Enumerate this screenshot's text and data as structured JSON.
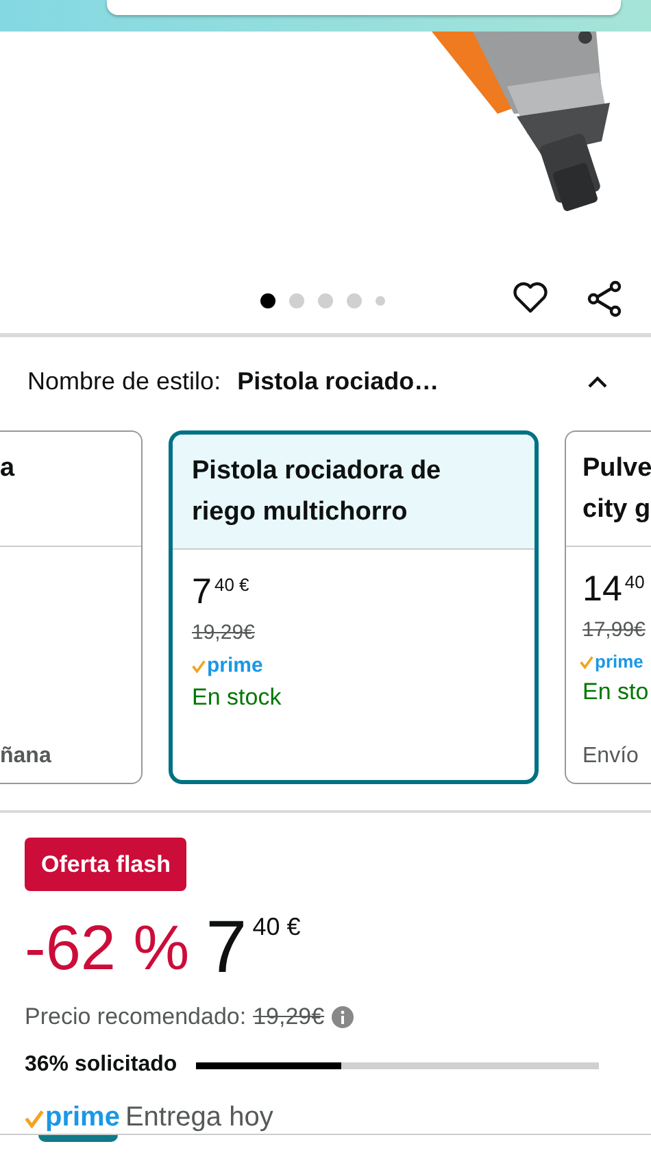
{
  "header": {
    "search": {
      "kind": "field"
    }
  },
  "gallery": {
    "dots": [
      {
        "selected": true
      },
      {
        "selected": false
      },
      {
        "selected": false
      },
      {
        "selected": false
      },
      {
        "selected": false,
        "small": true
      }
    ],
    "favorite": {
      "on": false
    }
  },
  "style_selector": {
    "label": "Nombre de estilo:",
    "value": "Pistola rociado…",
    "expanded": true
  },
  "style_cards": [
    {
      "selected": false,
      "title_lines": [
        "a"
      ],
      "delivery": "ñana"
    },
    {
      "selected": true,
      "title_lines": [
        "Pistola rociadora de",
        "riego multichorro"
      ],
      "price": {
        "whole": "7",
        "fraction": "40",
        "currency": "€"
      },
      "list_price": "19,29€",
      "prime": "prime",
      "availability": "En stock"
    },
    {
      "selected": false,
      "title_lines": [
        "Pulve",
        "city g"
      ],
      "price": {
        "whole": "14",
        "fraction": "40"
      },
      "list_price": "17,99€",
      "prime": "prime",
      "availability": "En sto",
      "delivery": "Envío"
    }
  ],
  "deal": {
    "badge": "Oferta flash",
    "discount": "-62 %",
    "price": {
      "whole": "7",
      "fraction": "40",
      "currency": "€"
    },
    "list_price_label": "Precio recomendado:",
    "list_price": "19,29€",
    "claimed": {
      "label": "36% solicitado",
      "level": 0.36
    },
    "prime": "prime",
    "delivery": "Entrega hoy"
  }
}
